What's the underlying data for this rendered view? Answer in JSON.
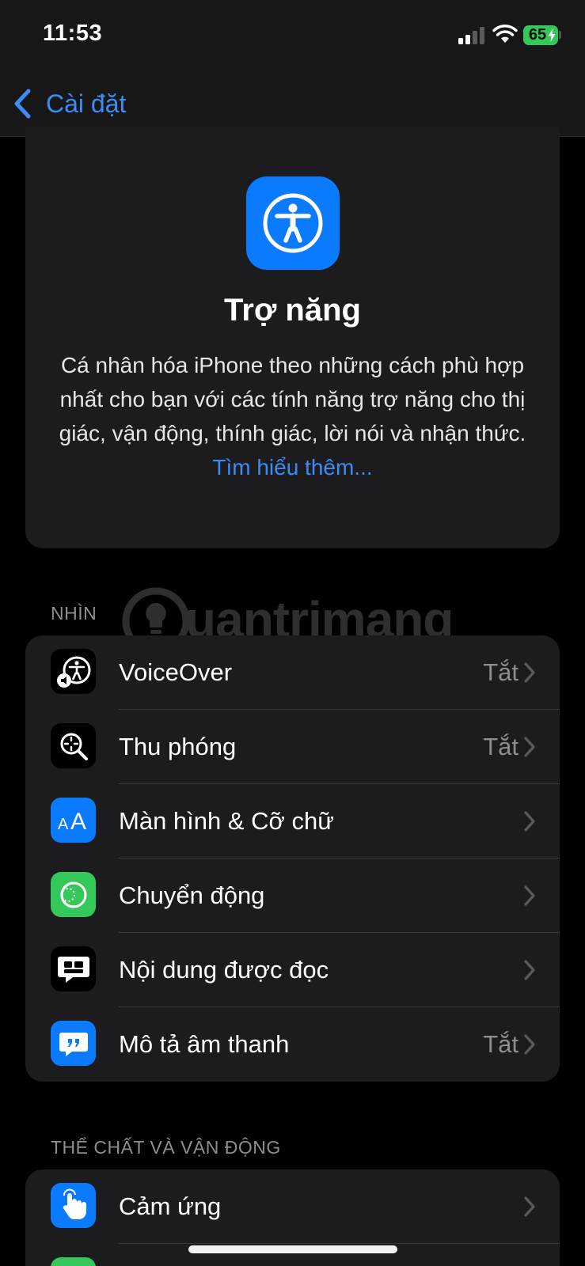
{
  "status_bar": {
    "time": "11:53",
    "battery": "65"
  },
  "nav": {
    "back_label": "Cài đặt"
  },
  "header": {
    "title": "Trợ năng",
    "description": "Cá nhân hóa iPhone theo những cách phù hợp nhất cho bạn với các tính năng trợ năng cho thị giác, vận động, thính giác, lời nói và nhận thức.",
    "link": "Tìm hiểu thêm..."
  },
  "watermark": {
    "text": "uantrimang"
  },
  "sections": [
    {
      "title": "NHÌN",
      "items": [
        {
          "label": "VoiceOver",
          "value": "Tắt",
          "icon": "voiceover-icon",
          "icon_bg": "#000000"
        },
        {
          "label": "Thu phóng",
          "value": "Tắt",
          "icon": "zoom-icon",
          "icon_bg": "#000000"
        },
        {
          "label": "Màn hình & Cỡ chữ",
          "value": "",
          "icon": "text-size-icon",
          "icon_bg": "#0a7aff"
        },
        {
          "label": "Chuyển động",
          "value": "",
          "icon": "motion-icon",
          "icon_bg": "#34c759"
        },
        {
          "label": "Nội dung được đọc",
          "value": "",
          "icon": "spoken-content-icon",
          "icon_bg": "#000000"
        },
        {
          "label": "Mô tả âm thanh",
          "value": "Tắt",
          "icon": "audio-description-icon",
          "icon_bg": "#0a7aff"
        }
      ]
    },
    {
      "title": "THỂ CHẤT VÀ VẬN ĐỘNG",
      "items": [
        {
          "label": "Cảm ứng",
          "value": "",
          "icon": "touch-icon",
          "icon_bg": "#0a7aff"
        }
      ]
    }
  ],
  "colors": {
    "accent": "#3b8cf5",
    "background": "#000000",
    "card": "#1c1c1e",
    "secondary_text": "#8d8d93"
  }
}
